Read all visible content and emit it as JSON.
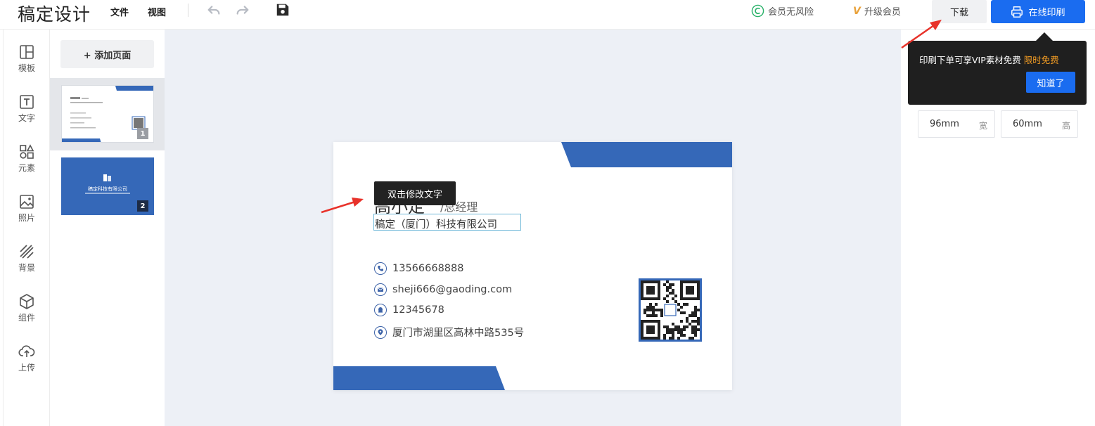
{
  "app": {
    "logo": "稿定设计"
  },
  "header": {
    "menu_file": "文件",
    "menu_view": "视图",
    "vip_safe": "会员无风险",
    "upgrade": "升级会员",
    "download": "下载",
    "print_online": "在线印刷"
  },
  "toolbar": {
    "items": [
      {
        "label": "模板",
        "icon": "template-icon"
      },
      {
        "label": "文字",
        "icon": "text-icon"
      },
      {
        "label": "元素",
        "icon": "elements-icon"
      },
      {
        "label": "照片",
        "icon": "photo-icon"
      },
      {
        "label": "背景",
        "icon": "background-icon"
      },
      {
        "label": "组件",
        "icon": "component-icon"
      },
      {
        "label": "上传",
        "icon": "upload-icon"
      }
    ]
  },
  "pages": {
    "add_label": "+ 添加页面",
    "thumbs": [
      {
        "number": "1"
      },
      {
        "number": "2",
        "company": "稿定科技有限公司"
      }
    ]
  },
  "card": {
    "name_partial": "高小定",
    "title": "/总经理",
    "company": "稿定（厦门）科技有限公司",
    "phone": "13566668888",
    "email": "sheji666@gaoding.com",
    "qq": "12345678",
    "address": "厦门市湖里区高林中路535号",
    "accent_color": "#3568b8"
  },
  "tooltip": {
    "text": "双击修改文字"
  },
  "popup": {
    "text": "印刷下单可享VIP素材免费 ",
    "highlight": "限时免费",
    "button": "知道了"
  },
  "size": {
    "width_value": "96mm",
    "width_unit": "宽",
    "height_value": "60mm",
    "height_unit": "高"
  }
}
